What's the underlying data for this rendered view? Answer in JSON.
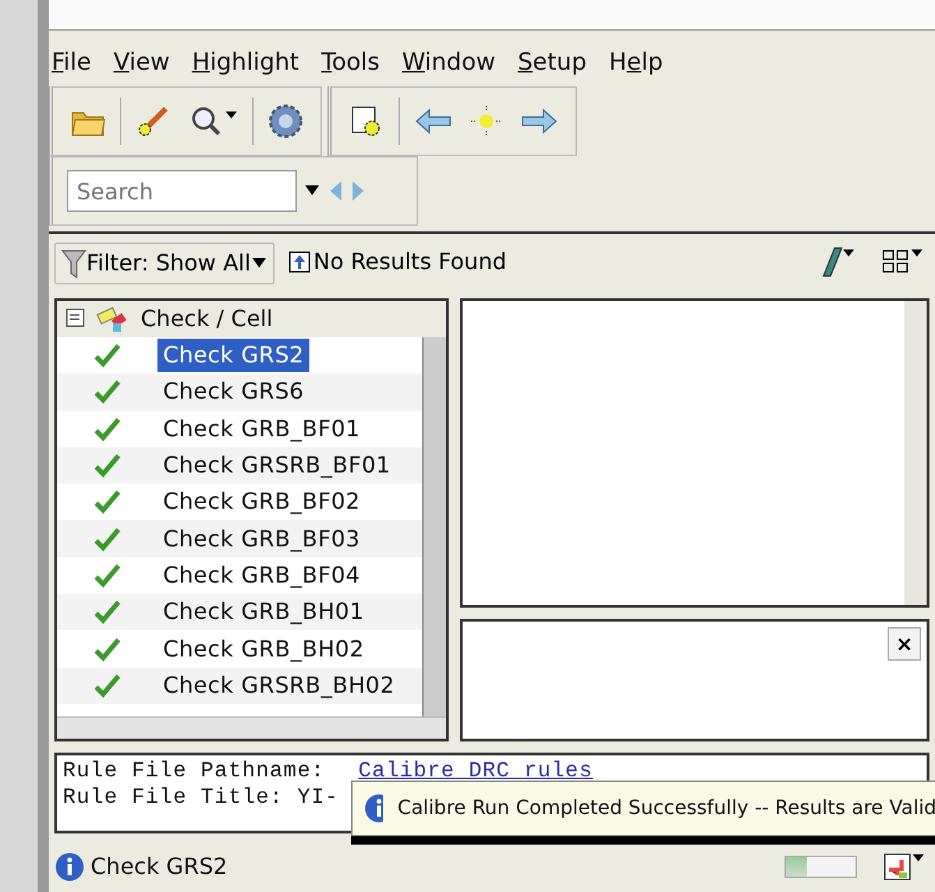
{
  "menu": [
    {
      "mnemonic": "F",
      "rest": "ile"
    },
    {
      "mnemonic": "V",
      "rest": "iew"
    },
    {
      "mnemonic": "H",
      "rest": "ighlight"
    },
    {
      "mnemonic": "T",
      "rest": "ools"
    },
    {
      "mnemonic": "W",
      "rest": "indow"
    },
    {
      "mnemonic": "S",
      "rest": "etup"
    },
    {
      "prefix": "H",
      "mnemonic": "e",
      "rest": "lp"
    }
  ],
  "preview": {
    "close": "×"
  },
  "search": {
    "placeholder": "Search"
  },
  "filter": {
    "label": "Filter: Show All",
    "results": "No Results Found"
  },
  "tree": {
    "column": "Check / Cell",
    "rows": [
      {
        "label": "Check GRS2",
        "passed": true,
        "selected": true
      },
      {
        "label": "Check GRS6",
        "passed": true,
        "selected": false
      },
      {
        "label": "Check GRB_BF01",
        "passed": true,
        "selected": false
      },
      {
        "label": "Check GRSRB_BF01",
        "passed": true,
        "selected": false
      },
      {
        "label": "Check GRB_BF02",
        "passed": true,
        "selected": false
      },
      {
        "label": "Check GRB_BF03",
        "passed": true,
        "selected": false
      },
      {
        "label": "Check GRB_BF04",
        "passed": true,
        "selected": false
      },
      {
        "label": "Check GRB_BH01",
        "passed": true,
        "selected": false
      },
      {
        "label": "Check GRB_BH02",
        "passed": true,
        "selected": false
      },
      {
        "label": "Check GRSRB_BH02",
        "passed": true,
        "selected": false
      }
    ]
  },
  "output": {
    "lines": [
      {
        "label": "Rule File Pathname:",
        "value": "Calibre DRC rules"
      },
      {
        "label": "Rule File Title: YI-"
      }
    ]
  },
  "notification": {
    "text": "Calibre Run Completed Successfully -- Results are Valid"
  },
  "status_bar": {
    "text": "Check GRS2",
    "progress": {
      "level": 0.3
    }
  }
}
